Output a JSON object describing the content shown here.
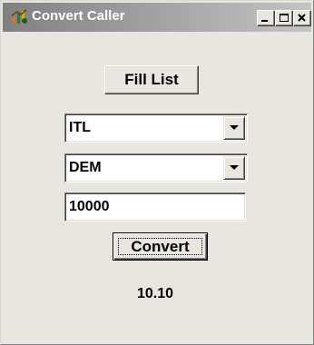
{
  "window": {
    "title": "Convert Caller",
    "icon": "app-icon",
    "caption_buttons": [
      "minimize",
      "maximize",
      "close"
    ]
  },
  "form": {
    "fill_list_label": "Fill List",
    "from_currency": "ITL",
    "to_currency": "DEM",
    "amount": "10000",
    "convert_label": "Convert",
    "result": "10.10"
  }
}
